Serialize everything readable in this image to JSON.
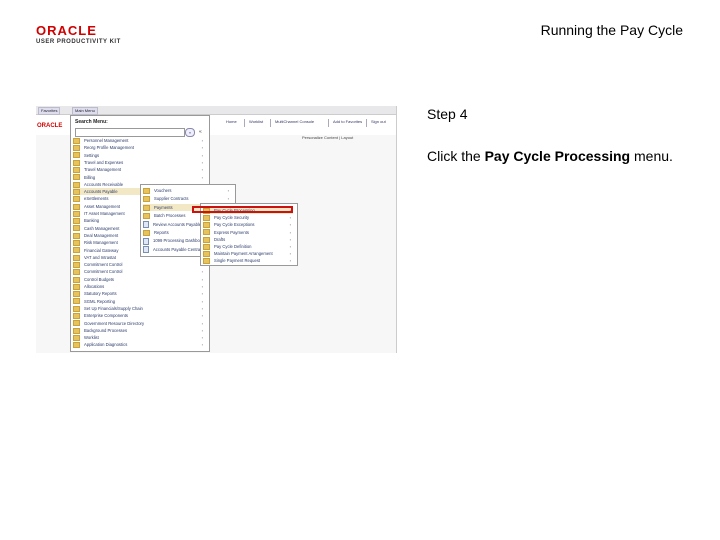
{
  "logo": {
    "brand": "ORACLE",
    "product": "USER PRODUCTIVITY KIT"
  },
  "title": "Running the Pay Cycle",
  "step": "Step 4",
  "instruction": {
    "prefix": "Click the ",
    "target": "Pay Cycle Processing",
    "suffix": " menu."
  },
  "screenshot": {
    "topbar": {
      "favorites": "Favorites",
      "main_menu": "Main Menu"
    },
    "header": {
      "brand": "ORACLE",
      "links": [
        "Home",
        "Worklist",
        "MultiChannel Console",
        "Add to Favorites",
        "Sign out"
      ],
      "personalize": "Personalize Content | Layout"
    },
    "menu": {
      "title": "Search Menu:",
      "search_go": "»",
      "collapse": "«",
      "items": [
        "Personnel Management",
        "Reorg Profile Management",
        "Settings",
        "Travel and Expenses",
        "Travel Management",
        "Billing",
        "Accounts Receivable",
        "Accounts Payable",
        "eSettlements",
        "Asset Management",
        "IT Asset Management",
        "Banking",
        "Cash Management",
        "Deal Management",
        "Risk Management",
        "Financial Gateway",
        "VAT and Intrastat",
        "Commitment Control",
        "Commitment Control",
        "Control Budgets",
        "Allocations",
        "Statutory Reports",
        "SGML Reporting",
        "Set Up Financials/Supply Chain",
        "Enterprise Components",
        "Government Resource Directory",
        "Background Processes",
        "Worklist",
        "Application Diagnostics"
      ],
      "selected_index": 7
    },
    "submenu1": {
      "items": [
        "Vouchers",
        "Supplier Contracts",
        "Payments",
        "Batch Processes",
        "Review Accounts Payable Info",
        "Reports",
        "1099 Processing Dashboard",
        "Accounts Payable Central"
      ],
      "selected_index": 2
    },
    "submenu2": {
      "items": [
        "Pay Cycle Processing",
        "Pay Cycle Security",
        "Pay Cycle Exceptions",
        "Express Payments",
        "Drafts",
        "Pay Cycle Definition",
        "Maintain Payment Arrangement",
        "Single Payment Request"
      ],
      "selected_index": 0
    }
  }
}
